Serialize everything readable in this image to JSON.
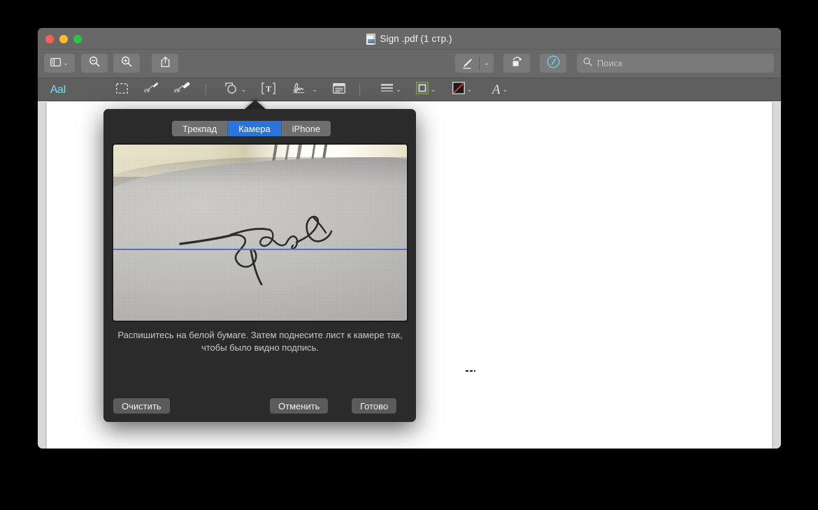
{
  "window": {
    "title": "Sign .pdf (1 стр.)",
    "doc_icon": "pdf-document-icon",
    "traffic_lights": {
      "close": "#ff5f57",
      "minimize": "#ffbd2e",
      "maximize": "#28c840"
    }
  },
  "toolbar": {
    "sidebar_label": "sidebar-toggle",
    "zoom_out_label": "zoom-out",
    "zoom_in_label": "zoom-in",
    "share_label": "share",
    "markup_label": "markup-toggle",
    "rotate_label": "rotate-left",
    "annotate_label": "annotation-tool",
    "search": {
      "placeholder": "Поиск",
      "value": "",
      "icon": "search-icon"
    }
  },
  "markup_toolbar": {
    "items": [
      {
        "name": "text-selection",
        "glyph": "AaI",
        "active": true
      },
      {
        "name": "rectangular-selection",
        "glyph": "",
        "active": false
      },
      {
        "name": "sketch",
        "glyph": "",
        "active": false
      },
      {
        "name": "draw",
        "glyph": "",
        "active": false
      },
      {
        "name": "shapes",
        "glyph": "",
        "active": false
      },
      {
        "name": "text-box",
        "glyph": "T",
        "active": false
      },
      {
        "name": "sign",
        "glyph": "",
        "active": false
      },
      {
        "name": "note",
        "glyph": "",
        "active": false
      },
      {
        "name": "line-style",
        "glyph": "",
        "active": false
      },
      {
        "name": "border-color",
        "glyph": "",
        "active": false
      },
      {
        "name": "fill-color",
        "glyph": "",
        "active": false
      },
      {
        "name": "text-style",
        "glyph": "A",
        "active": false
      }
    ],
    "chevron": "⌄"
  },
  "popover": {
    "title": "signature-capture",
    "tabs": [
      {
        "label": "Трекпад",
        "selected": false
      },
      {
        "label": "Камера",
        "selected": true
      },
      {
        "label": "iPhone",
        "selected": false
      }
    ],
    "hint": "Распишитесь на белой бумаге. Затем поднесите лист к камере так, чтобы было видно подпись.",
    "buttons": {
      "clear": "Очистить",
      "cancel": "Отменить",
      "done": "Готово"
    },
    "camera": {
      "guide_line_color": "#4a72d8",
      "caption": "live-camera-preview-with-handwritten-signature"
    },
    "colors": {
      "panel_bg": "#2b2b2b",
      "tab_selected": "#2d74da",
      "button_bg": "#5b5b5b"
    }
  },
  "document": {
    "page_background": "#ffffff",
    "marker": "signature-drop-marker"
  }
}
